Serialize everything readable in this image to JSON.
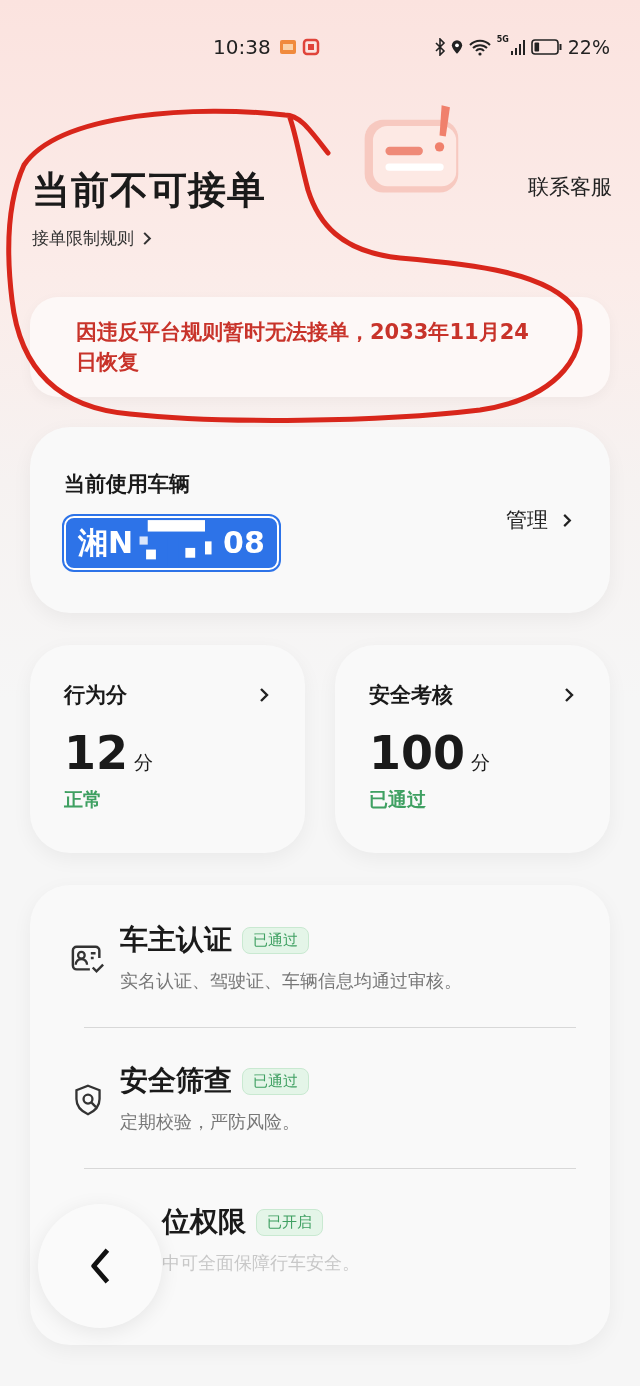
{
  "status_bar": {
    "time": "10:38",
    "network": "5G",
    "battery": "22%"
  },
  "header": {
    "title": "当前不可接单",
    "rules_link": "接单限制规则",
    "contact": "联系客服"
  },
  "notice": "因违反平台规则暂时无法接单，2033年11月24日恢复",
  "vehicle": {
    "label": "当前使用车辆",
    "plate_start": "湘N",
    "plate_end": "08",
    "manage": "管理"
  },
  "scores": [
    {
      "title": "行为分",
      "value": "12",
      "unit": "分",
      "status": "正常"
    },
    {
      "title": "安全考核",
      "value": "100",
      "unit": "分",
      "status": "已通过"
    }
  ],
  "checks": [
    {
      "kind": "id-card",
      "title": "车主认证",
      "badge": "已通过",
      "description": "实名认证、驾驶证、车辆信息均通过审核。"
    },
    {
      "kind": "shield-search",
      "title": "安全筛查",
      "badge": "已通过",
      "description": "定期校验，严防风险。"
    },
    {
      "kind": "hidden",
      "title": "位权限",
      "badge": "已开启",
      "description": "中可全面保障行车安全。"
    }
  ]
}
